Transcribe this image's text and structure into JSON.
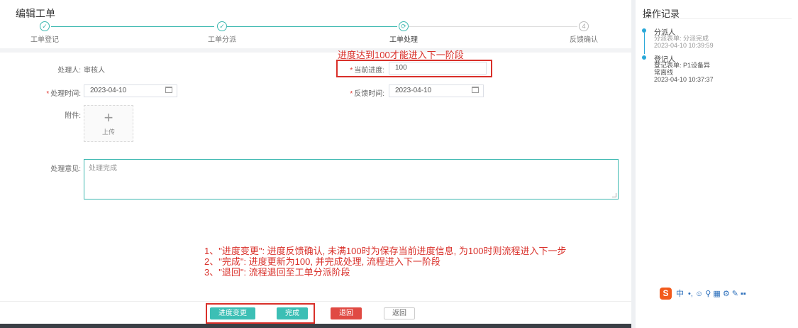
{
  "header": {
    "title": "编辑工单"
  },
  "steps": [
    {
      "label": "工单登记",
      "icon": "✓"
    },
    {
      "label": "工单分派",
      "icon": "✓"
    },
    {
      "label": "工单处理",
      "icon": "⟳"
    },
    {
      "label": "反馈确认",
      "icon": "4"
    }
  ],
  "annotation_top": "进度达到100才能进入下一阶段",
  "form": {
    "handler_label": "处理人:",
    "handler_value": "审核人",
    "progress_label": "当前进度:",
    "progress_value": "100",
    "handle_time_label": "处理时间:",
    "handle_time_value": "2023-04-10",
    "feedback_time_label": "反馈时间:",
    "feedback_time_value": "2023-04-10",
    "attachment_label": "附件:",
    "upload_plus": "+",
    "upload_label": "上传",
    "opinion_label": "处理意见:",
    "opinion_value": "处理完成",
    "required_mark": "*"
  },
  "notes": [
    "1、\"进度变更\": 进度反馈确认, 未满100时为保存当前进度信息, 为100时则流程进入下一步",
    "2、\"完成\": 进度更新为100, 并完成处理, 流程进入下一阶段",
    "3、\"退回\": 流程退回至工单分派阶段"
  ],
  "buttons": {
    "progress_change": "进度变更",
    "complete": "完成",
    "reject": "退回",
    "back": "返回"
  },
  "sidebar": {
    "title": "操作记录",
    "records": [
      {
        "name": "分派人",
        "desc1": "分派表单: 分派完成",
        "time": "2023-04-10 10:39:59"
      },
      {
        "name": "登记人",
        "desc1": "登记表单: P1设备异",
        "desc2": "常离线",
        "time": "2023-04-10 10:37:37"
      }
    ]
  },
  "ime_toolbar": {
    "logo": "S",
    "lang": "中",
    "items": "•, ☺ ⚲ ▦ ⚙ ✎ ▪▪"
  },
  "colors": {
    "accent": "#3cb8b0",
    "annotation": "#d9302a",
    "danger": "#e04a43",
    "timeline": "#2aa8d8"
  }
}
